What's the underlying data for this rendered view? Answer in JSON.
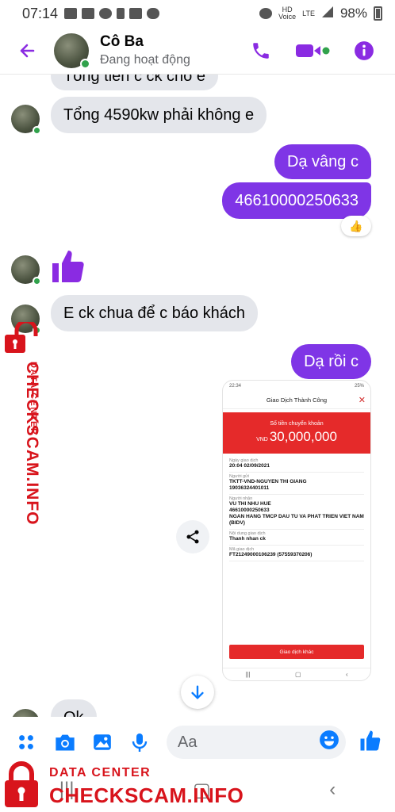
{
  "status_bar": {
    "time": "07:14",
    "network": "LTE",
    "hd_label": "HD",
    "voice_label": "Voice",
    "battery": "98%"
  },
  "header": {
    "contact_name": "Cô Ba",
    "status": "Đang hoạt động"
  },
  "messages": [
    {
      "direction": "incoming",
      "text": "Tổng tiền c ck cho e"
    },
    {
      "direction": "incoming",
      "text": "Tổng 4590kw phải không e"
    },
    {
      "direction": "outgoing",
      "text": "Dạ vâng c"
    },
    {
      "direction": "outgoing",
      "text": "46610000250633",
      "reaction": "👍"
    },
    {
      "direction": "incoming",
      "text": "👍"
    },
    {
      "direction": "incoming",
      "text": "E ck chua để c báo khách"
    },
    {
      "direction": "outgoing",
      "text": "Dạ rồi c"
    },
    {
      "direction": "incoming",
      "text": "Ok"
    }
  ],
  "receipt": {
    "status_time": "22:34",
    "status_battery": "25%",
    "title": "Giao Dịch Thành Công",
    "amount_label": "Số tiền chuyển khoản",
    "currency": "VND",
    "amount": "30,000,000",
    "fields": [
      {
        "label": "Ngày giao dịch",
        "value": "20:04 02/09/2021"
      },
      {
        "label": "Người gửi",
        "value": "TKTT-VND-NGUYEN THI GIANG\n19036324401011"
      },
      {
        "label": "Người nhận",
        "value": "VU THI NHU HUE\n46610000250633\nNGAN HANG TMCP DAU TU VA PHAT TRIEN VIET NAM (BIDV)"
      },
      {
        "label": "Nội dung giao dịch",
        "value": "Thanh nhan ck"
      },
      {
        "label": "Mã giao dịch",
        "value": "FT21249000106239 (57559370206)"
      }
    ],
    "button_label": "Giao dịch khác"
  },
  "composer": {
    "placeholder": "Aa"
  },
  "watermark": {
    "line1": "DATA CENTER",
    "line2": "CHECKSCAM.INFO"
  },
  "colors": {
    "accent": "#7f35e6",
    "incoming_bubble": "#e4e6eb",
    "online": "#31a24c",
    "receipt_red": "#e52a2a",
    "watermark_red": "#d8141c"
  }
}
